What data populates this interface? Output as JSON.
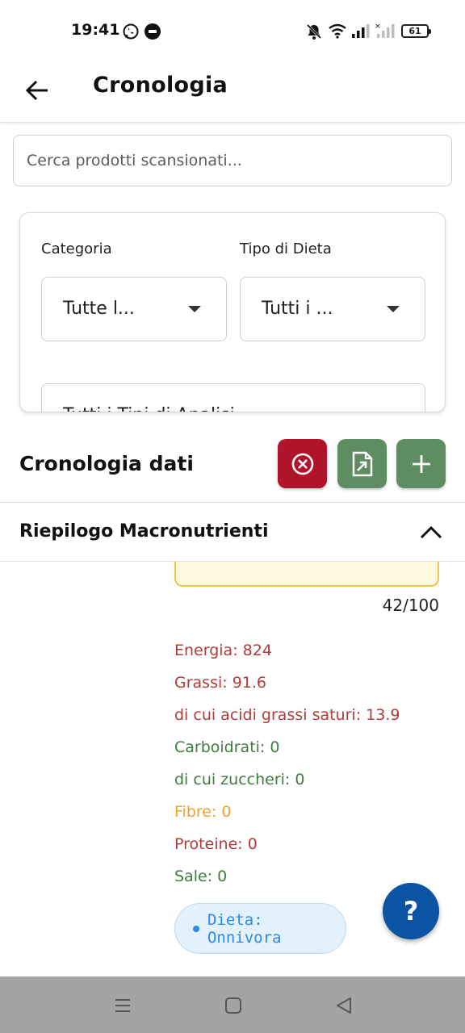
{
  "status_bar": {
    "time": "19:41",
    "battery": "61",
    "icons": [
      "whatsapp-icon",
      "app-notification-icon",
      "mute-icon",
      "wifi-icon",
      "signal-icon",
      "signal-noservice-icon",
      "battery-icon"
    ]
  },
  "app_bar": {
    "title": "Cronologia"
  },
  "search": {
    "placeholder": "Cerca prodotti scansionati..."
  },
  "filters": {
    "category_label": "Categoria",
    "category_value": "Tutte l...",
    "diet_label": "Tipo di Dieta",
    "diet_value": "Tutti i ...",
    "analysis_value": "Tutti i Tipi di Analisi"
  },
  "history": {
    "title": "Cronologia dati",
    "colors": {
      "delete": "#b0142a",
      "export": "#5f8d62",
      "add": "#5f8d62"
    }
  },
  "macro": {
    "title": "Riepilogo Macronutrienti"
  },
  "product": {
    "score": "42/100",
    "nutrients": [
      {
        "text": "Energia: 824",
        "color": "red"
      },
      {
        "text": "Grassi: 91.6",
        "color": "red"
      },
      {
        "text": "di cui acidi grassi saturi: 13.9",
        "color": "red"
      },
      {
        "text": "Carboidrati: 0",
        "color": "green"
      },
      {
        "text": "di cui zuccheri: 0",
        "color": "green"
      },
      {
        "text": "Fibre: 0",
        "color": "amber"
      },
      {
        "text": "Proteine: 0",
        "color": "red"
      },
      {
        "text": "Sale: 0",
        "color": "green"
      }
    ],
    "diet": "Dieta: Onnivora"
  },
  "help": {
    "label": "?"
  }
}
